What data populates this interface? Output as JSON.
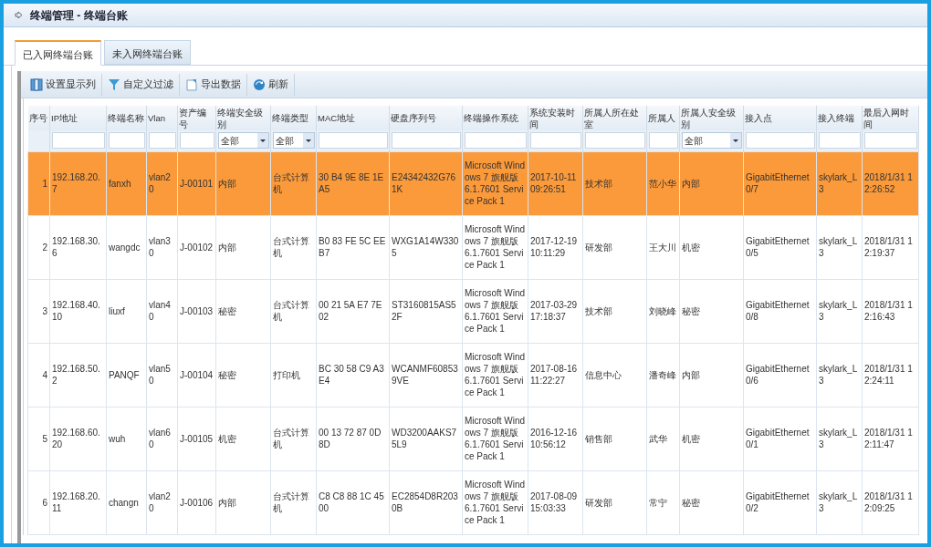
{
  "window": {
    "title": "终端管理 - 终端台账"
  },
  "tabs": [
    {
      "label": "已入网终端台账",
      "selected": true
    },
    {
      "label": "未入网终端台账",
      "selected": false
    }
  ],
  "toolbar": [
    "设置显示列",
    "自定义过滤",
    "导出数据",
    "刷新"
  ],
  "table": {
    "columns": [
      "序号",
      "IP地址",
      "终端名称",
      "Vlan",
      "资产编号",
      "终端安全级别",
      "终端类型",
      "MAC地址",
      "硬盘序列号",
      "终端操作系统",
      "系统安装时间",
      "所属人所在处室",
      "所属人",
      "所属人安全级别",
      "接入点",
      "接入终端",
      "最后入网时间"
    ],
    "filters": [
      {
        "kind": "none"
      },
      {
        "kind": "text"
      },
      {
        "kind": "text"
      },
      {
        "kind": "text"
      },
      {
        "kind": "text"
      },
      {
        "kind": "select",
        "value": "全部"
      },
      {
        "kind": "select",
        "value": "全部"
      },
      {
        "kind": "text"
      },
      {
        "kind": "text"
      },
      {
        "kind": "text"
      },
      {
        "kind": "text"
      },
      {
        "kind": "text"
      },
      {
        "kind": "text"
      },
      {
        "kind": "select",
        "value": "全部"
      },
      {
        "kind": "text"
      },
      {
        "kind": "text"
      },
      {
        "kind": "text"
      }
    ],
    "rows": [
      {
        "selected": true,
        "cells": [
          "1",
          "192.168.20.7",
          "fanxh",
          "vlan20",
          "J-00101",
          "内部",
          "台式计算机",
          "30 B4 9E 8E 1E A5",
          "E24342432G761K",
          "Microsoft Windows 7 旗舰版 6.1.7601 Service Pack 1",
          "2017-10-11 09:26:51",
          "技术部",
          "范小华",
          "内部",
          "GigabitEthernet0/7",
          "skylark_L3",
          "2018/1/31 12:26:52"
        ]
      },
      {
        "selected": false,
        "cells": [
          "2",
          "192.168.30.6",
          "wangdc",
          "vlan30",
          "J-00102",
          "内部",
          "台式计算机",
          "B0 83 FE 5C EE B7",
          "WXG1A14W3305",
          "Microsoft Windows 7 旗舰版 6.1.7601 Service Pack 1",
          "2017-12-19 10:11:29",
          "研发部",
          "王大川",
          "机密",
          "GigabitEthernet0/5",
          "skylark_L3",
          "2018/1/31 12:19:37"
        ]
      },
      {
        "selected": false,
        "cells": [
          "3",
          "192.168.40.10",
          "liuxf",
          "vlan40",
          "J-00103",
          "秘密",
          "台式计算机",
          "00 21 5A E7 7E 02",
          "ST3160815AS52F",
          "Microsoft Windows 7 旗舰版 6.1.7601 Service Pack 1",
          "2017-03-29 17:18:37",
          "技术部",
          "刘晓峰",
          "秘密",
          "GigabitEthernet0/8",
          "skylark_L3",
          "2018/1/31 12:16:43"
        ]
      },
      {
        "selected": false,
        "cells": [
          "4",
          "192.168.50.2",
          "PANQF",
          "vlan50",
          "J-00104",
          "秘密",
          "打印机",
          "BC 30 58 C9 A3 E4",
          "WCANMF608539VE",
          "Microsoft Windows 7 旗舰版 6.1.7601 Service Pack 1",
          "2017-08-16 11:22:27",
          "信息中心",
          "潘奇峰",
          "内部",
          "GigabitEthernet0/6",
          "skylark_L3",
          "2018/1/31 12:24:11"
        ]
      },
      {
        "selected": false,
        "cells": [
          "5",
          "192.168.60.20",
          "wuh",
          "vlan60",
          "J-00105",
          "机密",
          "台式计算机",
          "00 13 72 87 0D 8D",
          "WD3200AAKS75L9",
          "Microsoft Windows 7 旗舰版 6.1.7601 Service Pack 1",
          "2016-12-16 10:56:12",
          "销售部",
          "武华",
          "机密",
          "GigabitEthernet0/1",
          "skylark_L3",
          "2018/1/31 12:11:47"
        ]
      },
      {
        "selected": false,
        "cells": [
          "6",
          "192.168.20.11",
          "changn",
          "vlan20",
          "J-00106",
          "内部",
          "台式计算机",
          "C8 C8 88 1C 45 00",
          "EC2854D8R2030B",
          "Microsoft Windows 7 旗舰版 6.1.7601 Service Pack 1",
          "2017-08-09 15:03:33",
          "研发部",
          "常宁",
          "秘密",
          "GigabitEthernet0/2",
          "skylark_L3",
          "2018/1/31 12:09:25"
        ]
      }
    ]
  }
}
